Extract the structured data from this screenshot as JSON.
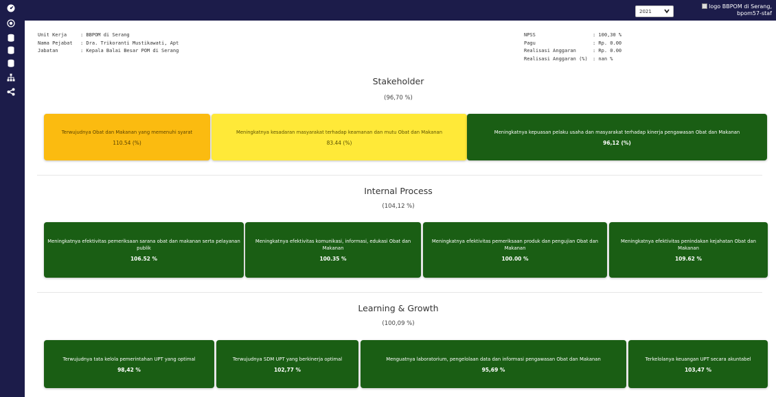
{
  "rail": {
    "icons": [
      "dashboard-icon",
      "target-icon",
      "database-icon",
      "database-icon",
      "database-icon",
      "sitemap-icon",
      "share-icon"
    ]
  },
  "topbar": {
    "year_selected": "2021",
    "logo_alt": "logo BBPOM di Serang, bpom57-staf"
  },
  "info_left": [
    {
      "label": "Unit Kerja",
      "value": ": BBPOM di Serang"
    },
    {
      "label": "Nama Pejabat",
      "value": ": Dra. Trikoranti Mustikawati, Apt"
    },
    {
      "label": "Jabatan",
      "value": ": Kepala Balai Besar POM di Serang"
    }
  ],
  "info_right": [
    {
      "label": "NPSS",
      "value": ": 100,30 %"
    },
    {
      "label": "Pagu",
      "value": ": Rp. 0.00"
    },
    {
      "label": "Realisasi Anggaran",
      "value": ": Rp. 0.00"
    },
    {
      "label": "Realisasi Anggaran (%)",
      "value": ": nan %"
    }
  ],
  "sections": {
    "stakeholder": {
      "title": "Stakeholder",
      "value": "(96,70 %)",
      "cards": [
        {
          "text": "Terwujudnya Obat dan Makanan yang memenuhi syarat",
          "value": "110.54 (%)",
          "color": "#fbbb10"
        },
        {
          "text": "Meningkatnya kesadaran masyarakat terhadap keamanan dan mutu Obat dan Makanan",
          "value": "83.44 (%)",
          "color": "#ffe938"
        },
        {
          "text": "Meningkatnya kepuasan pelaku usaha dan masyarakat terhadap kinerja pengawasan Obat dan Makanan",
          "value": "96,12 (%)",
          "color": "#1a5e14"
        }
      ]
    },
    "internal": {
      "title": "Internal Process",
      "value": "(104,12 %)",
      "cards": [
        {
          "text": "Meningkatnya efektivitas pemeriksaan sarana obat dan makanan serta pelayanan publik",
          "value": "106.52 %"
        },
        {
          "text": "Meningkatnya efektivitas komunikasi, informasi, edukasi Obat dan Makanan",
          "value": "100.35 %"
        },
        {
          "text": "Meningkatnya efektivitas pemeriksaan produk dan pengujian Obat dan Makanan",
          "value": "100.00 %"
        },
        {
          "text": "Meningkatnya efektivitas penindakan kejahatan Obat dan Makanan",
          "value": "109.62 %"
        }
      ]
    },
    "learning": {
      "title": "Learning & Growth",
      "value": "(100,09 %)",
      "cards": [
        {
          "text": "Terwujudnya tata kelola pemerintahan UPT yang optimal",
          "value": "98,42 %"
        },
        {
          "text": "Terwujudnya SDM UPT yang berkinerja optimal",
          "value": "102,77 %"
        },
        {
          "text": "Menguatnya laboratorium, pengelolaan data dan informasi pengawasan Obat dan Makanan",
          "value": "95,69 %"
        },
        {
          "text": "Terkelolanya keuangan UPT secara akuntabel",
          "value": "103,47 %"
        }
      ]
    }
  }
}
